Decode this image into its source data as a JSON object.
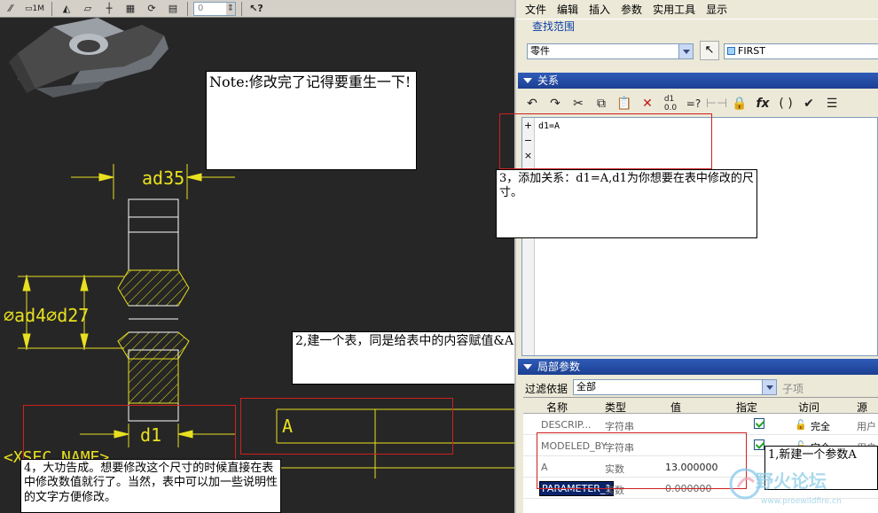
{
  "cad": {
    "dims": {
      "top": "ad35",
      "left_diameters": "∅ad4∅d27",
      "bottom": "d1",
      "xsec": "<XSEC_NAME>",
      "table_cell": "A"
    }
  },
  "callouts": {
    "note": "Note:修改完了记得要重生一下!",
    "step2": "2,建一个表，同是给表中的内容赋值&A",
    "step3": "3，添加关系：d1=A,d1为你想要在表中修改的尺寸。",
    "step4": "4，大功告成。想要修改这个尺寸的时候直接在表中修改数值就行了。当然，表中可以加一些说明性的文字方便修改。",
    "step1": "1,新建一个参数A"
  },
  "menu": [
    "文件",
    "编辑",
    "插入",
    "参数",
    "实用工具",
    "显示"
  ],
  "search_scope": {
    "title": "查找范围",
    "scope_value": "零件",
    "model_name": "FIRST"
  },
  "relations": {
    "title": "关系",
    "text": "d1=A",
    "gutter": [
      "+",
      "−",
      "×"
    ]
  },
  "params": {
    "title": "局部参数",
    "filter_label": "过滤依据",
    "filter_value": "全部",
    "sub_label": "子项",
    "headers": {
      "name": "名称",
      "type": "类型",
      "value": "值",
      "designate": "指定",
      "access": "访问",
      "source": "源"
    },
    "rows": [
      {
        "name": "DESCRIP...",
        "type": "字符串",
        "value": "",
        "access": "完全",
        "source": "用户"
      },
      {
        "name": "MODELED_BY",
        "type": "字符串",
        "value": "",
        "access": "完全",
        "source": "用户"
      },
      {
        "name": "A",
        "type": "实数",
        "value": "13.000000",
        "access": "",
        "source": ""
      },
      {
        "name": "PARAMETER_1",
        "type": "实数",
        "value": "0.000000",
        "access": "",
        "source": ""
      }
    ]
  },
  "colors": {
    "cad_bg": "#262626",
    "cad_line": "#e8e020",
    "annot_red": "#d02020",
    "panel_bg": "#ece9d8",
    "bar_blue": "#1b3f92"
  }
}
